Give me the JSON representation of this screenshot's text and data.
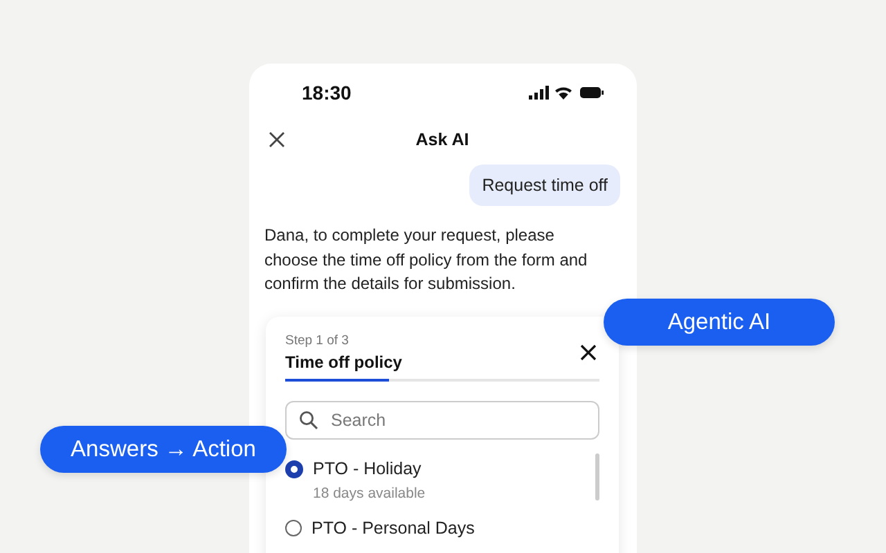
{
  "status_bar": {
    "time": "18:30"
  },
  "header": {
    "title": "Ask AI"
  },
  "user_message": "Request time off",
  "assistant_message": "Dana, to complete your request, please choose the time off policy from the form and confirm the details for submission.",
  "form": {
    "step": "Step 1 of 3",
    "title": "Time off policy",
    "progress": {
      "level": 0.33
    },
    "search": {
      "placeholder": "Search"
    },
    "options": [
      {
        "name": "PTO - Holiday",
        "detail": "18 days available",
        "selected": true
      },
      {
        "name": "PTO - Personal Days",
        "selected": false
      }
    ]
  },
  "callouts": [
    {
      "label": "Agentic AI"
    },
    {
      "label": "Answers → Action"
    }
  ]
}
